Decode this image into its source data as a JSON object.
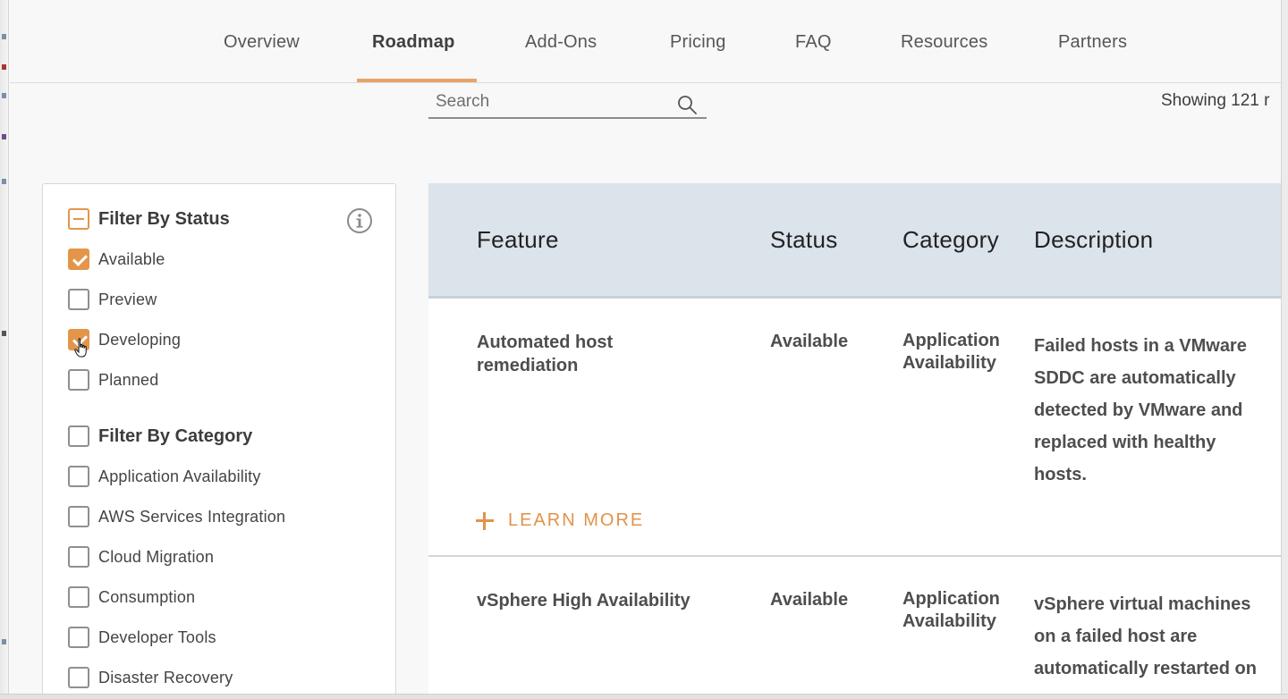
{
  "nav": {
    "items": [
      {
        "label": "Overview"
      },
      {
        "label": "Roadmap"
      },
      {
        "label": "Add-Ons"
      },
      {
        "label": "Pricing"
      },
      {
        "label": "FAQ"
      },
      {
        "label": "Resources"
      },
      {
        "label": "Partners"
      }
    ],
    "active": "Roadmap"
  },
  "search": {
    "placeholder": "Search",
    "value": ""
  },
  "results": {
    "showing_text": "Showing 121 r"
  },
  "filters": {
    "status": {
      "heading": "Filter By Status",
      "state": "partial",
      "options": [
        {
          "label": "Available",
          "checked": true
        },
        {
          "label": "Preview",
          "checked": false
        },
        {
          "label": "Developing",
          "checked": true
        },
        {
          "label": "Planned",
          "checked": false
        }
      ]
    },
    "category": {
      "heading": "Filter By Category",
      "checked": false,
      "options": [
        {
          "label": "Application Availability",
          "checked": false
        },
        {
          "label": "AWS Services Integration",
          "checked": false
        },
        {
          "label": "Cloud Migration",
          "checked": false
        },
        {
          "label": "Consumption",
          "checked": false
        },
        {
          "label": "Developer Tools",
          "checked": false
        },
        {
          "label": "Disaster Recovery",
          "checked": false
        }
      ]
    }
  },
  "table": {
    "headers": {
      "feature": "Feature",
      "status": "Status",
      "category": "Category",
      "description": "Description"
    },
    "rows": [
      {
        "feature_line1": "Automated host",
        "feature_line2": "remediation",
        "status": "Available",
        "category_line1": "Application",
        "category_line2": "Availability",
        "desc_lines": [
          "Failed hosts in a VMware",
          "SDDC are automatically",
          "detected by VMware and",
          "replaced with healthy",
          "hosts."
        ],
        "learn_more": "LEARN MORE"
      },
      {
        "feature_line1": "vSphere High Availability",
        "status": "Available",
        "category_line1": "Application",
        "category_line2": "Availability",
        "desc_lines": [
          "vSphere virtual machines",
          "on a failed host are",
          "automatically restarted on"
        ]
      }
    ]
  },
  "colors": {
    "accent": "#e4954a",
    "header_bg": "#dbe3eb",
    "nav_underline": "#e8a468"
  },
  "icons": {
    "search": "search-icon",
    "info": "info-icon",
    "cursor": "hand-pointer-icon",
    "plus": "plus-icon"
  }
}
